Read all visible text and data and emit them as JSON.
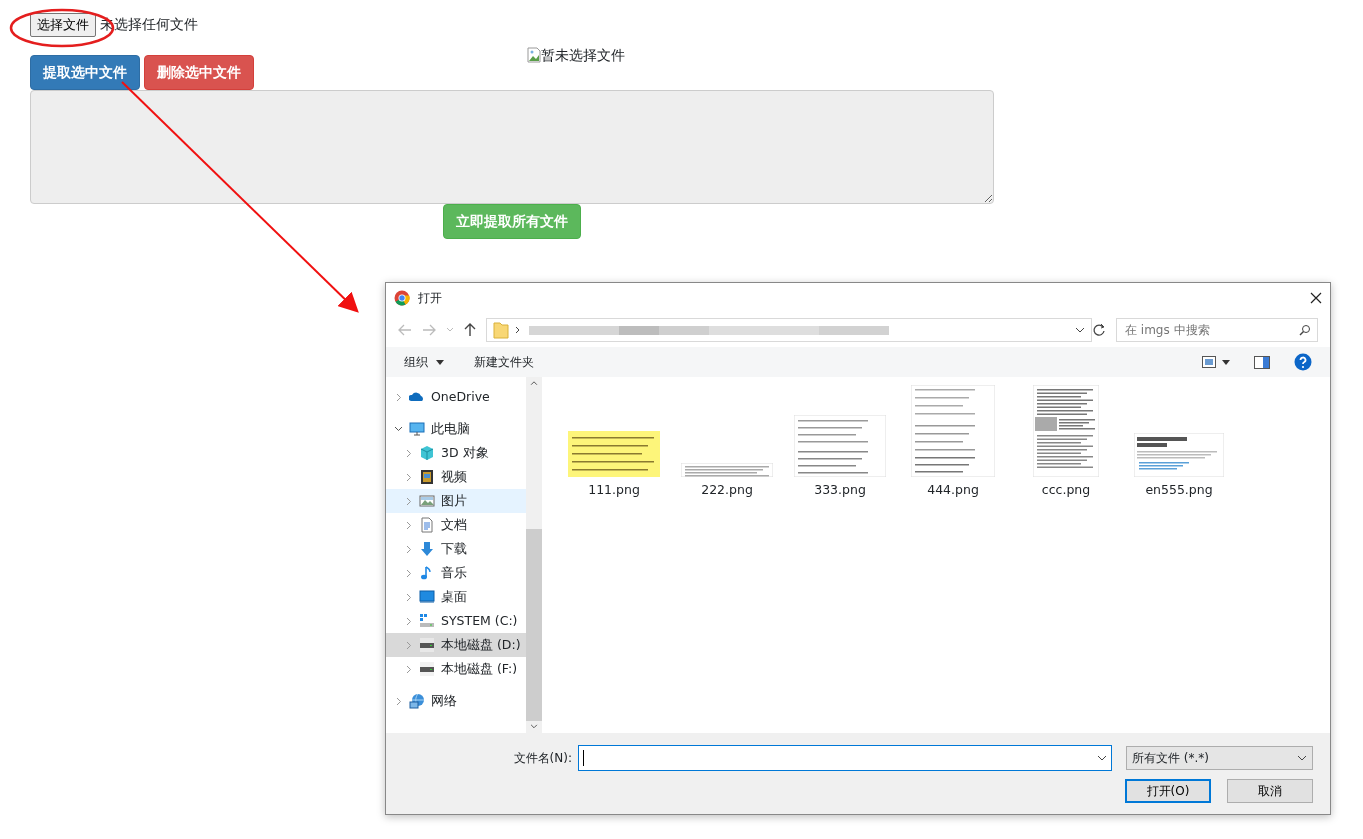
{
  "page": {
    "file_button": "选择文件",
    "file_status": "未选择任何文件",
    "image_alt": "暂未选择文件",
    "buttons": [
      {
        "label": "提取选中文件",
        "kind": "primary"
      },
      {
        "label": "删除选中文件",
        "kind": "danger"
      }
    ],
    "extract_all_button": "立即提取所有文件"
  },
  "dialog": {
    "title": "打开",
    "search": {
      "placeholder": "在 imgs 中搜索"
    },
    "toolbar": [
      "组织",
      "新建文件夹"
    ],
    "sidebar": [
      {
        "label": "OneDrive",
        "expanded": false,
        "selected": false,
        "hovered": false
      },
      {
        "label": "此电脑",
        "expanded": true,
        "selected": false,
        "hovered": false,
        "children": [
          {
            "label": "3D 对象",
            "expanded": false,
            "selected": false,
            "hovered": false
          },
          {
            "label": "视频",
            "expanded": false,
            "selected": false,
            "hovered": false
          },
          {
            "label": "图片",
            "expanded": false,
            "selected": false,
            "hovered": true
          },
          {
            "label": "文档",
            "expanded": false,
            "selected": false,
            "hovered": false
          },
          {
            "label": "下载",
            "expanded": false,
            "selected": false,
            "hovered": false
          },
          {
            "label": "音乐",
            "expanded": false,
            "selected": false,
            "hovered": false
          },
          {
            "label": "桌面",
            "expanded": false,
            "selected": false,
            "hovered": false
          },
          {
            "label": "SYSTEM (C:)",
            "expanded": false,
            "selected": false,
            "hovered": false
          },
          {
            "label": "本地磁盘 (D:)",
            "expanded": false,
            "selected": true,
            "hovered": false
          },
          {
            "label": "本地磁盘 (F:)",
            "expanded": false,
            "selected": false,
            "hovered": false
          }
        ]
      },
      {
        "label": "网络",
        "expanded": false,
        "selected": false,
        "hovered": false
      }
    ],
    "files": [
      {
        "name": "111.png"
      },
      {
        "name": "222.png"
      },
      {
        "name": "333.png"
      },
      {
        "name": "444.png"
      },
      {
        "name": "ccc.png"
      },
      {
        "name": "en555.png"
      }
    ],
    "filename_label": "文件名(N):",
    "filetype": "所有文件 (*.*)",
    "open_button": "打开(O)",
    "cancel_button": "取消"
  }
}
